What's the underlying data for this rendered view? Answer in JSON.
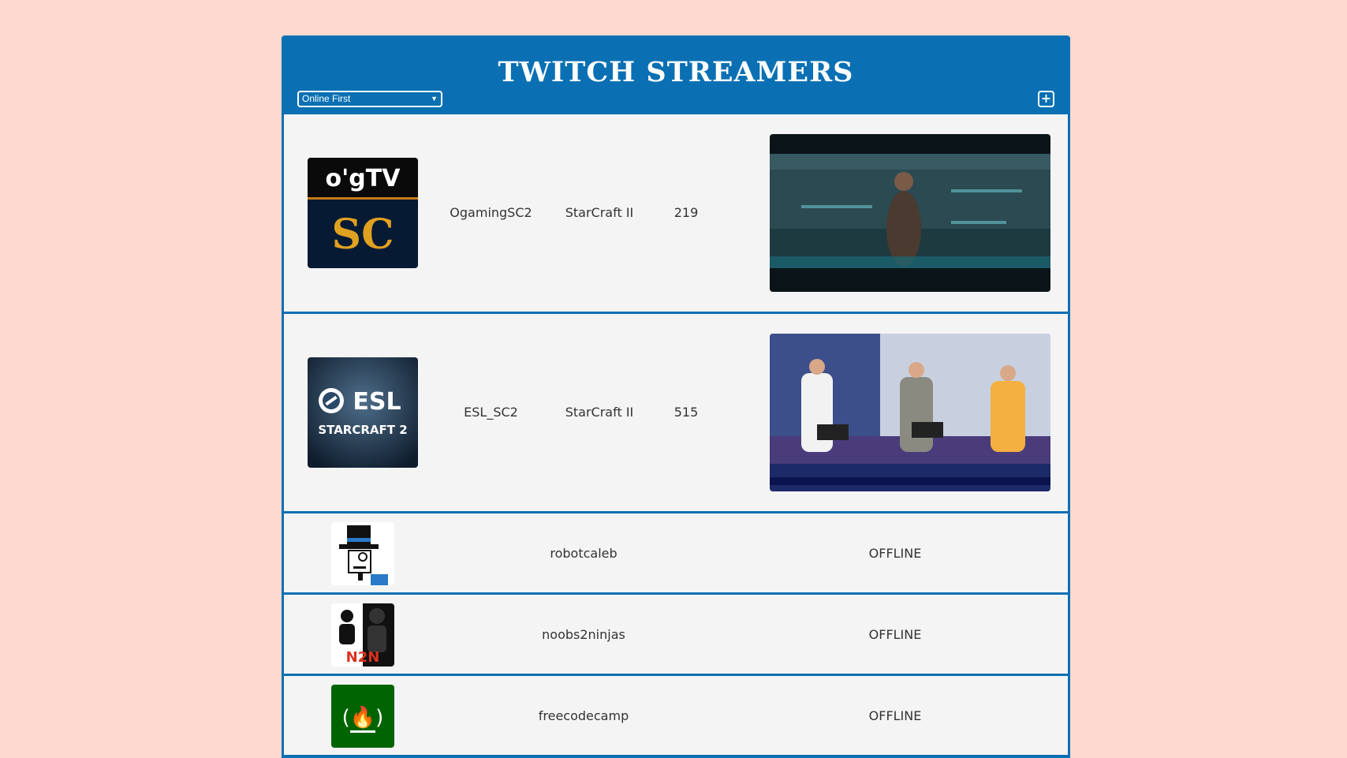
{
  "header": {
    "title": "TWITCH STREAMERS",
    "sort_selected": "Online First",
    "add_label": "+"
  },
  "streamers": [
    {
      "name": "OgamingSC2",
      "game": "StarCraft II",
      "viewers": "219",
      "status": "online",
      "avatar_text_top": "o'gTV",
      "avatar_text_bottom": "SC"
    },
    {
      "name": "ESL_SC2",
      "game": "StarCraft II",
      "viewers": "515",
      "status": "online",
      "avatar_text_top": "ESL",
      "avatar_text_bottom": "STARCRAFT 2"
    },
    {
      "name": "robotcaleb",
      "status_text": "OFFLINE",
      "status": "offline"
    },
    {
      "name": "noobs2ninjas",
      "status_text": "OFFLINE",
      "status": "offline",
      "avatar_text": "N2N"
    },
    {
      "name": "freecodecamp",
      "status_text": "OFFLINE",
      "status": "offline",
      "avatar_text": "(🔥)"
    }
  ],
  "colors": {
    "page_bg": "#fdd9cf",
    "accent": "#0a70b3",
    "row_bg": "#f4f4f4"
  }
}
